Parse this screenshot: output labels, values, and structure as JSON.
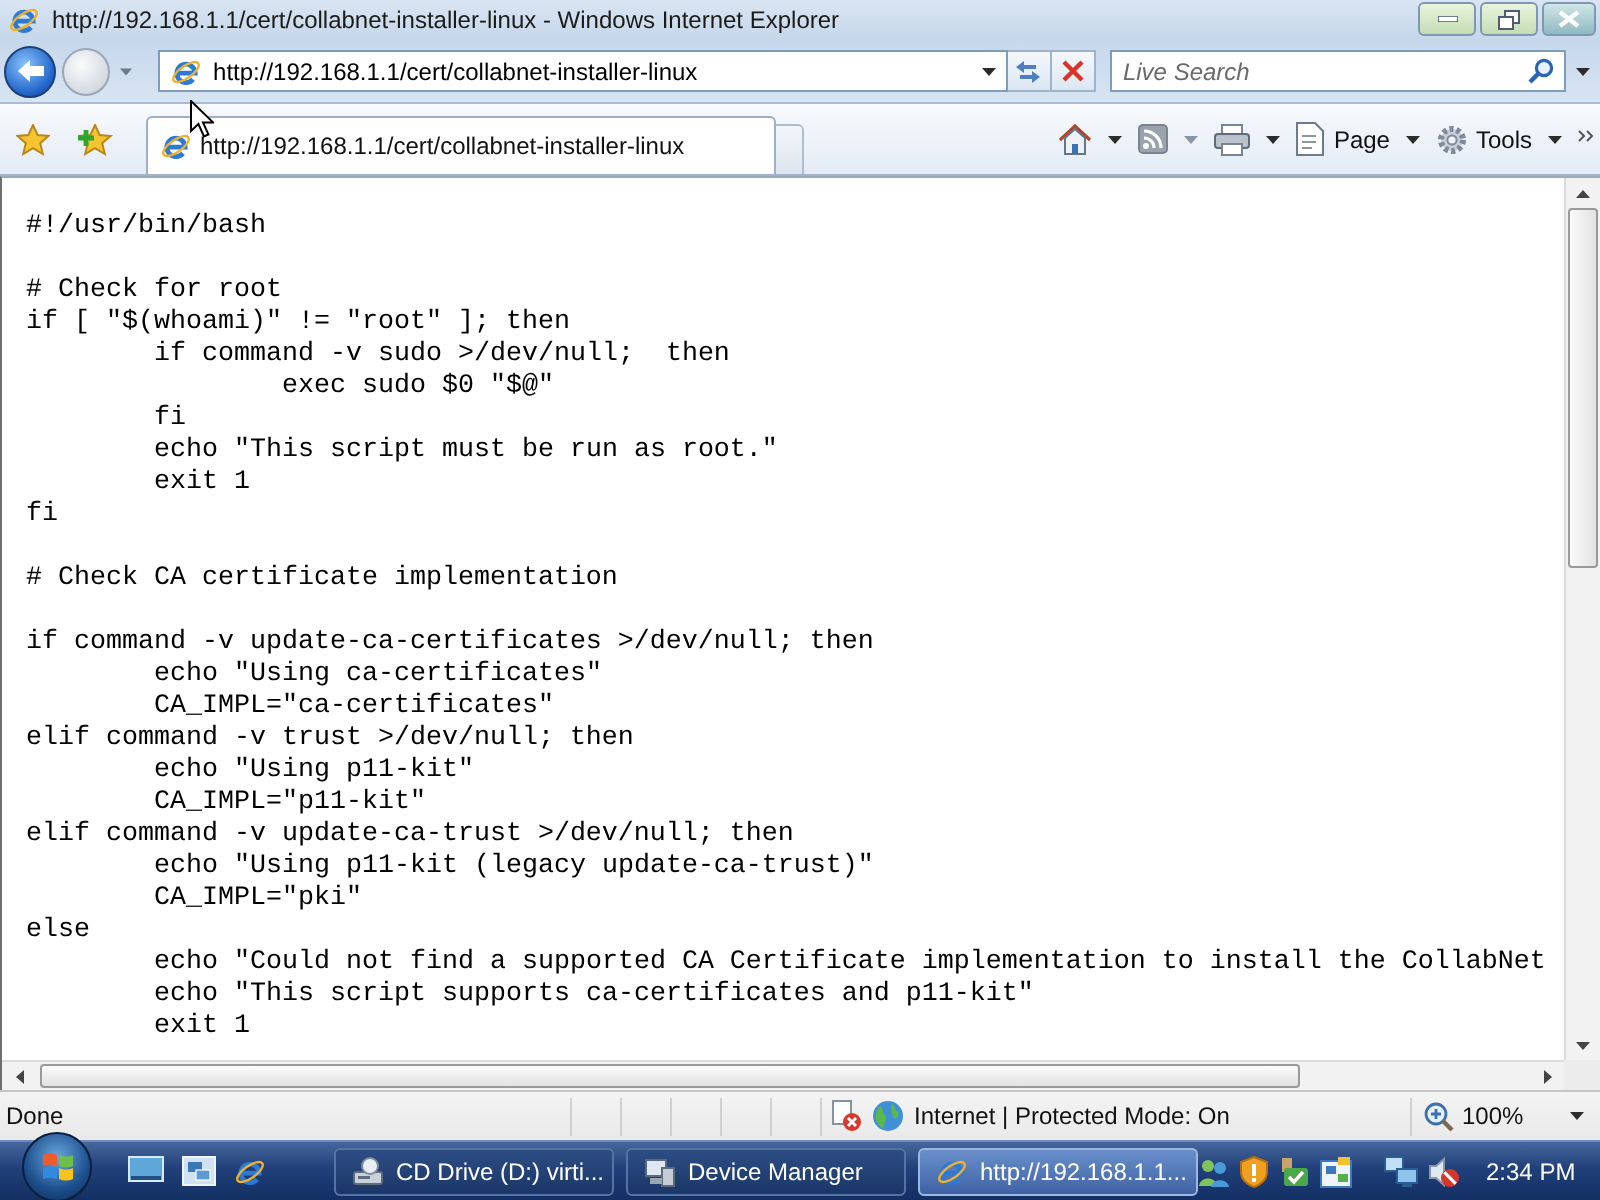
{
  "window": {
    "title": "http://192.168.1.1/cert/collabnet-installer-linux - Windows Internet Explorer"
  },
  "nav_bar": {
    "back_button": {
      "disabled": false
    },
    "forward_button": {
      "disabled": true
    },
    "address": "http://192.168.1.1/cert/collabnet-installer-linux",
    "search": {
      "placeholder": "Live Search"
    }
  },
  "tab_bar": {
    "tabs": [
      {
        "label": "http://192.168.1.1/cert/collabnet-installer-linux",
        "selected": true
      }
    ],
    "page_menu": "Page",
    "tools_menu": "Tools"
  },
  "page": {
    "code_blocks": [
      [
        {
          "text": "#!/usr/bin/bash"
        }
      ],
      [
        {
          "text": "# Check for root"
        },
        {
          "text": "if [ \"$(whoami)\" != \"root\" ]; then",
          "children": [
            {
              "text": "if command -v sudo >/dev/null;  then",
              "children": [
                {
                  "text": "exec sudo $0 \"$@\""
                }
              ]
            },
            {
              "text": "fi"
            },
            {
              "text": "echo \"This script must be run as root.\""
            },
            {
              "text": "exit 1"
            }
          ]
        },
        {
          "text": "fi"
        }
      ],
      [
        {
          "text": "# Check CA certificate implementation"
        }
      ],
      [
        {
          "text": "if command -v update-ca-certificates >/dev/null; then",
          "children": [
            {
              "text": "echo \"Using ca-certificates\""
            },
            {
              "text": "CA_IMPL=\"ca-certificates\""
            }
          ]
        },
        {
          "text": "elif command -v trust >/dev/null; then",
          "children": [
            {
              "text": "echo \"Using p11-kit\""
            },
            {
              "text": "CA_IMPL=\"p11-kit\""
            }
          ]
        },
        {
          "text": "elif command -v update-ca-trust >/dev/null; then",
          "children": [
            {
              "text": "echo \"Using p11-kit (legacy update-ca-trust)\""
            },
            {
              "text": "CA_IMPL=\"pki\""
            }
          ]
        },
        {
          "text": "else",
          "children": [
            {
              "text": "echo \"Could not find a supported CA Certificate implementation to install the CollabNet"
            },
            {
              "text": "echo \"This script supports ca-certificates and p11-kit\""
            },
            {
              "text": "exit 1"
            }
          ]
        }
      ]
    ]
  },
  "status_bar": {
    "status": "Done",
    "zone": "Internet | Protected Mode: On",
    "zoom": "100%"
  },
  "taskbar": {
    "tasks": [
      {
        "kind": "drive",
        "label": "CD Drive (D:) virti...",
        "selected": false
      },
      {
        "kind": "manager",
        "label": "Device Manager",
        "selected": false
      },
      {
        "kind": "browser",
        "label": "http://192.168.1.1...",
        "selected": true
      }
    ],
    "clock": "2:34 PM"
  }
}
